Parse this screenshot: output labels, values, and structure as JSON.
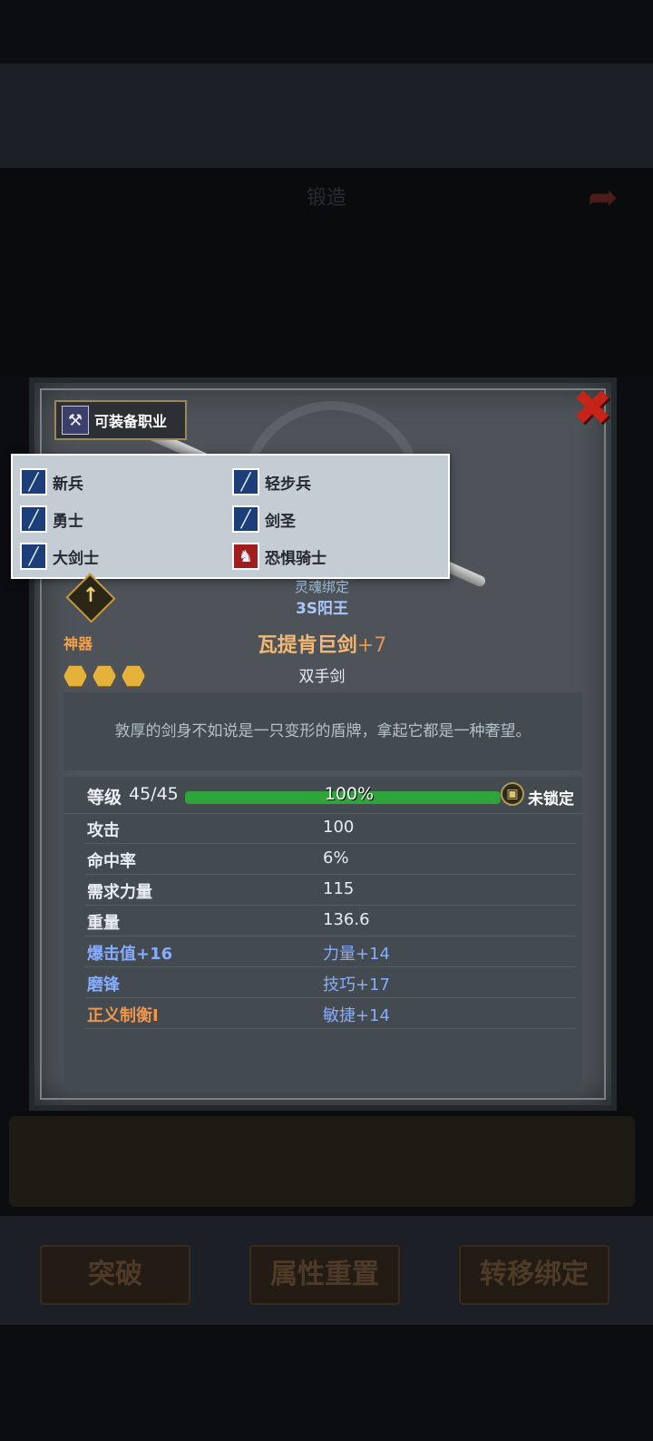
{
  "background": {
    "title": "锻造",
    "buttons": [
      "突破",
      "属性重置",
      "转移绑定"
    ]
  },
  "equip_tag": {
    "label": "可装备职业"
  },
  "jobs": [
    {
      "name": "新兵",
      "icon": "sword-icon"
    },
    {
      "name": "轻步兵",
      "icon": "sword-icon"
    },
    {
      "name": "勇士",
      "icon": "sword-icon"
    },
    {
      "name": "剑圣",
      "icon": "sword-icon"
    },
    {
      "name": "大剑士",
      "icon": "sword-icon"
    },
    {
      "name": "恐惧骑士",
      "icon": "horse-icon"
    }
  ],
  "item": {
    "bind": "灵魂绑定",
    "soul": "3S阳王",
    "tier": "神器",
    "name": "瓦提肯巨剑",
    "enhance": "+7",
    "type": "双手剑",
    "stars": 3,
    "description": "敦厚的剑身不如说是一只变形的盾牌，拿起它都是一种奢望。"
  },
  "level": {
    "label": "等级",
    "value": "45/45",
    "progress": 1.0,
    "progress_text": "100%",
    "lock_text": "未锁定"
  },
  "stats": [
    {
      "key": "攻击",
      "value": "100"
    },
    {
      "key": "命中率",
      "value": "6%"
    },
    {
      "key": "需求力量",
      "value": "115"
    },
    {
      "key": "重量",
      "value": "136.6"
    },
    {
      "key": "爆击值+16",
      "value": "力量+14"
    },
    {
      "key": "磨锋",
      "value": "技巧+17"
    },
    {
      "key": "正义制衡I",
      "value": "敏捷+14"
    }
  ],
  "colors": {
    "tier": "#f2a14c",
    "item_name": "#f3b874",
    "bonus_blue": "#86acff",
    "special_orange": "#f0954a",
    "exp_green": "#2ea43a",
    "close_red": "#c62418"
  }
}
